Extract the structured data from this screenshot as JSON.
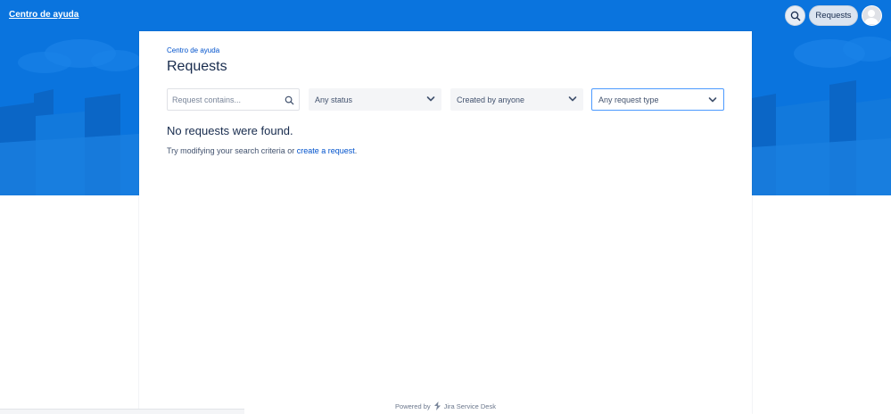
{
  "header": {
    "brand_link": "Centro de ayuda",
    "search_icon": "search-icon",
    "requests_button": "Requests",
    "avatar_icon": "user-avatar-icon"
  },
  "panel": {
    "breadcrumb": "Centro de ayuda",
    "title": "Requests",
    "filters": {
      "search_placeholder": "Request contains...",
      "status": "Any status",
      "creator": "Created by anyone",
      "request_type": "Any request type"
    },
    "empty": {
      "title": "No requests were found.",
      "desc_prefix": "Try modifying your search criteria or ",
      "desc_link": "create a request",
      "desc_suffix": "."
    }
  },
  "footer": {
    "powered_by": "Powered by",
    "product": "Jira Service Desk",
    "product_icon": "jira-service-desk-icon"
  },
  "colors": {
    "banner_blue": "#0a74de",
    "link_blue": "#0052cc",
    "text_dark": "#172b4d",
    "focus_border": "#4c9aff"
  }
}
